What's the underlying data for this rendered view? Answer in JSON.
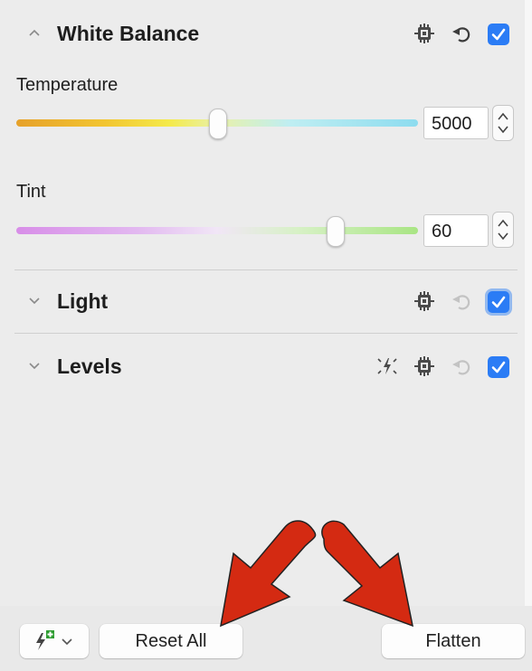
{
  "sections": [
    {
      "title": "White Balance",
      "expanded": true,
      "enabled": true
    },
    {
      "title": "Light",
      "expanded": false,
      "enabled": true
    },
    {
      "title": "Levels",
      "expanded": false,
      "enabled": true
    }
  ],
  "white_balance": {
    "temperature": {
      "label": "Temperature",
      "value": "5000",
      "slider_fraction": 0.5
    },
    "tint": {
      "label": "Tint",
      "value": "60",
      "slider_fraction": 0.8
    }
  },
  "footer": {
    "reset_label": "Reset All",
    "flatten_label": "Flatten"
  },
  "colors": {
    "accent": "#2b7cf5",
    "annotation_arrow": "#d42a12"
  },
  "icons": [
    "chevron-up-icon",
    "chevron-down-icon",
    "gear-icon",
    "revert-icon",
    "checkbox-checked-icon",
    "auto-enhance-icon",
    "add-preset-icon"
  ]
}
